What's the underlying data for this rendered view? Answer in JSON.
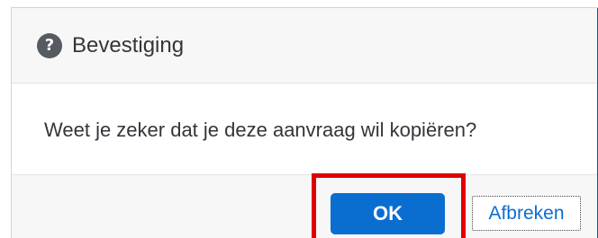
{
  "dialog": {
    "title": "Bevestiging",
    "icon": "help-icon",
    "message": "Weet je zeker dat je deze aanvraag wil kopiëren?",
    "ok_label": "OK",
    "cancel_label": "Afbreken"
  },
  "annotation": {
    "highlight_color": "#e00000"
  },
  "colors": {
    "accent": "#0a6ed1",
    "header_bg": "#f7f7f7",
    "text": "#32363a"
  }
}
